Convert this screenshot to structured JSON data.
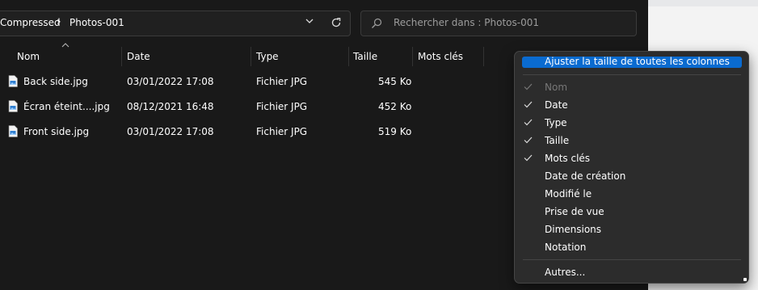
{
  "address": {
    "crumbs": [
      "Compressed",
      "Photos-001"
    ],
    "separator": "›"
  },
  "search": {
    "placeholder": "Rechercher dans : Photos-001"
  },
  "columns": [
    {
      "label": "Nom"
    },
    {
      "label": "Date"
    },
    {
      "label": "Type"
    },
    {
      "label": "Taille"
    },
    {
      "label": "Mots clés"
    }
  ],
  "files": [
    {
      "name": "Back side.jpg",
      "date": "03/01/2022 17:08",
      "type": "Fichier JPG",
      "size": "545 Ko"
    },
    {
      "name": "Écran éteint....jpg",
      "date": "08/12/2021 16:48",
      "type": "Fichier JPG",
      "size": "452 Ko"
    },
    {
      "name": "Front side.jpg",
      "date": "03/01/2022 17:08",
      "type": "Fichier JPG",
      "size": "519 Ko"
    }
  ],
  "context_menu": {
    "fit_all": "Ajuster la taille de toutes les colonnes",
    "items": [
      {
        "label": "Nom",
        "checked": true,
        "disabled": true
      },
      {
        "label": "Date",
        "checked": true
      },
      {
        "label": "Type",
        "checked": true
      },
      {
        "label": "Taille",
        "checked": true
      },
      {
        "label": "Mots clés",
        "checked": true
      },
      {
        "label": "Date de création",
        "checked": false
      },
      {
        "label": "Modifié le",
        "checked": false
      },
      {
        "label": "Prise de vue",
        "checked": false
      },
      {
        "label": "Dimensions",
        "checked": false
      },
      {
        "label": "Notation",
        "checked": false
      }
    ],
    "more": "Autres..."
  },
  "colors": {
    "background": "#191919",
    "highlight": "#0a6bd0",
    "text": "#ffffff",
    "muted": "#9c9c9c"
  },
  "icons": {
    "file": "jpg-file-icon",
    "search": "search-icon",
    "refresh": "refresh-icon",
    "chevron": "chevron-down-icon",
    "check": "check-icon",
    "sort": "sort-ascending-icon"
  }
}
